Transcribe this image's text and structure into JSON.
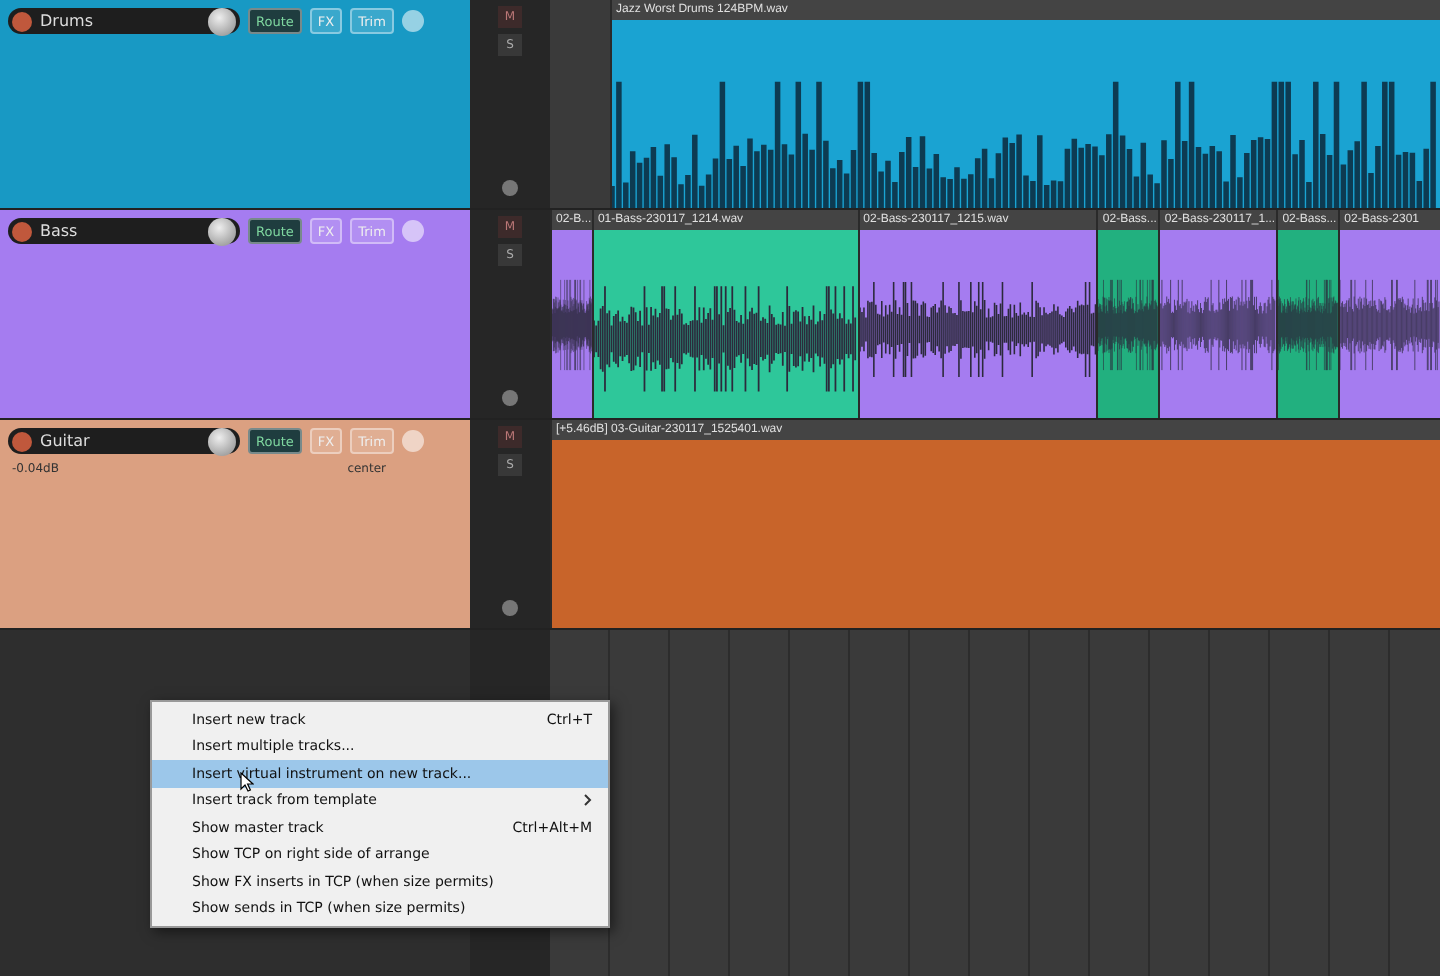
{
  "tracks": [
    {
      "name": "Drums",
      "color": "#1899c4",
      "buttons": {
        "route": "Route",
        "fx": "FX",
        "trim": "Trim"
      },
      "mute": "M",
      "solo": "S",
      "items": [
        {
          "label": "Jazz Worst Drums 124BPM.wav",
          "color": "#1aa3d2",
          "kind": "stereo"
        }
      ]
    },
    {
      "name": "Bass",
      "color": "#a57cf0",
      "buttons": {
        "route": "Route",
        "fx": "FX",
        "trim": "Trim"
      },
      "mute": "M",
      "solo": "S",
      "items": [
        {
          "label": "02-B...",
          "color": "#a57cf0",
          "kind": "mono"
        },
        {
          "label": "01-Bass-230117_1214.wav",
          "color": "#2ec79a",
          "kind": "mono"
        },
        {
          "label": "02-Bass-230117_1215.wav",
          "color": "#a57cf0",
          "kind": "mono"
        },
        {
          "label": "02-Bass...",
          "color": "#22b07f",
          "kind": "mono"
        },
        {
          "label": "02-Bass-230117_1...",
          "color": "#a57cf0",
          "kind": "mono"
        },
        {
          "label": "02-Bass...",
          "color": "#22b07f",
          "kind": "mono"
        },
        {
          "label": "02-Bass-2301",
          "color": "#a57cf0",
          "kind": "mono"
        }
      ]
    },
    {
      "name": "Guitar",
      "color": "#dba081",
      "volume": "-0.04dB",
      "pan": "center",
      "buttons": {
        "route": "Route",
        "fx": "FX",
        "trim": "Trim"
      },
      "mute": "M",
      "solo": "S",
      "items": [
        {
          "label": "[+5.46dB] 03-Guitar-230117_1525401.wav",
          "color": "#c8642a",
          "kind": "mono"
        }
      ]
    }
  ],
  "menu": [
    {
      "label": "Insert new track",
      "shortcut": "Ctrl+T",
      "submenu": false,
      "selected": false
    },
    {
      "label": "Insert multiple tracks...",
      "submenu": false,
      "selected": false
    },
    {
      "label": "Insert virtual instrument on new track...",
      "submenu": false,
      "selected": true
    },
    {
      "label": "Insert track from template",
      "submenu": true,
      "selected": false
    },
    {
      "label": "Show master track",
      "shortcut": "Ctrl+Alt+M",
      "submenu": false,
      "selected": false
    },
    {
      "label": "Show TCP on right side of arrange",
      "submenu": false,
      "selected": false
    },
    {
      "label": "Show FX inserts in TCP (when size permits)",
      "submenu": false,
      "selected": false
    },
    {
      "label": "Show sends in TCP (when size permits)",
      "submenu": false,
      "selected": false
    }
  ]
}
